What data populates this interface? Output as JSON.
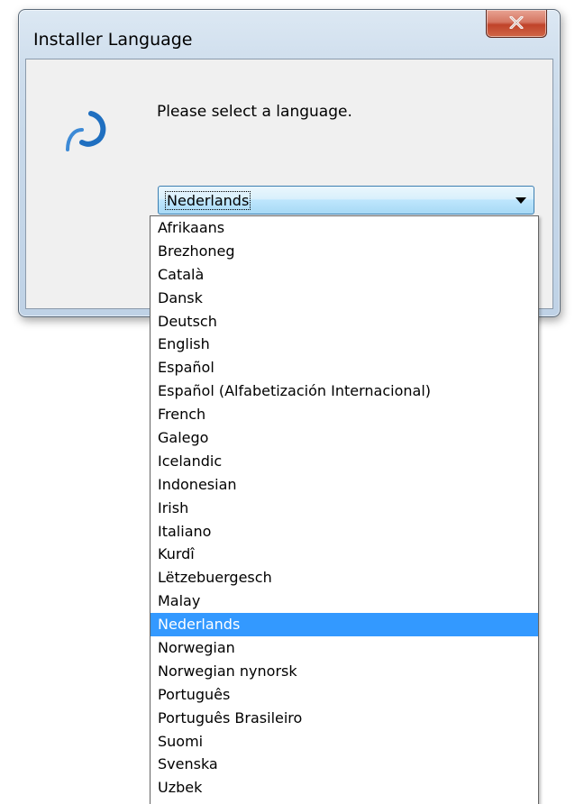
{
  "window": {
    "title": "Installer Language",
    "close_label": "Close"
  },
  "dialog": {
    "prompt": "Please select a language.",
    "selected_language": "Nederlands",
    "icon": "app-swirl-icon"
  },
  "dropdown": {
    "options": [
      "Afrikaans",
      "Brezhoneg",
      "Català",
      "Dansk",
      "Deutsch",
      "English",
      "Español",
      "Español (Alfabetización Internacional)",
      "French",
      "Galego",
      "Icelandic",
      "Indonesian",
      "Irish",
      "Italiano",
      "Kurdî",
      "Lëtzebuergesch",
      "Malay",
      "Nederlands",
      "Norwegian",
      "Norwegian nynorsk",
      "Português",
      "Português Brasileiro",
      "Suomi",
      "Svenska",
      "Uzbek"
    ],
    "selected_index": 17
  },
  "colors": {
    "selection": "#3399ff",
    "close_button": "#c7452c",
    "combo_border": "#3c7fb1",
    "icon_blue": "#1f6fc0"
  }
}
